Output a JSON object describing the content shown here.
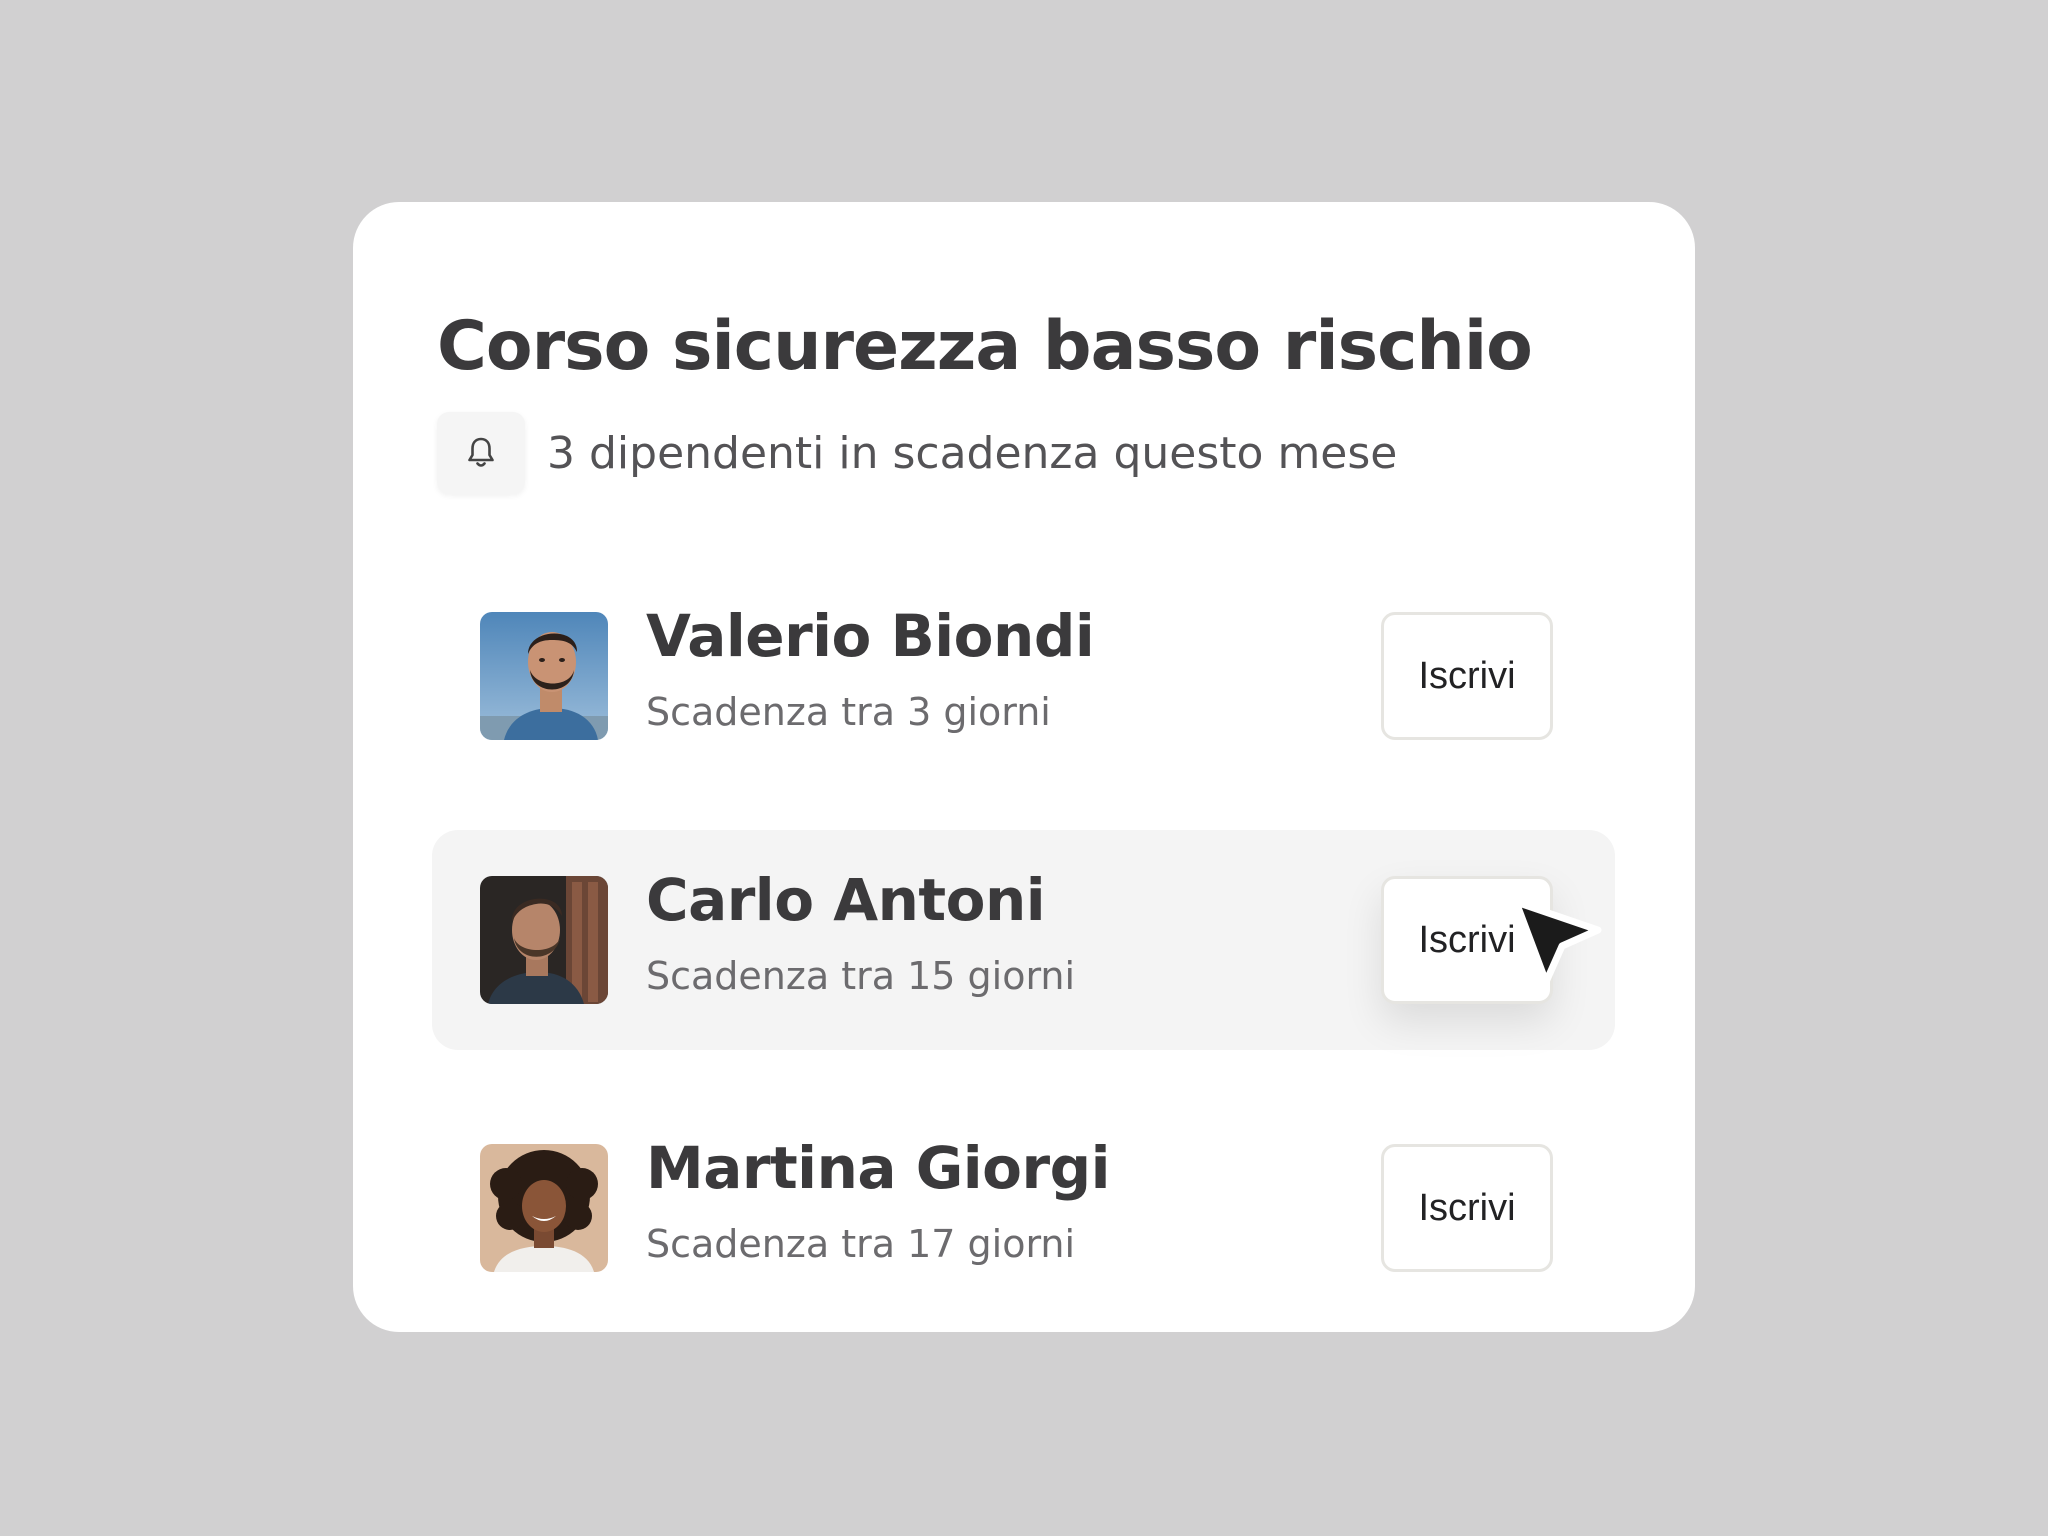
{
  "card": {
    "title": "Corso sicurezza basso rischio",
    "notice": {
      "icon": "bell-icon",
      "text": "3 dipendenti in scadenza questo mese"
    }
  },
  "employees": [
    {
      "name": "Valerio Biondi",
      "due": "Scadenza tra 3 giorni",
      "action_label": "Iscrivi",
      "highlighted": false
    },
    {
      "name": "Carlo Antoni",
      "due": "Scadenza tra 15 giorni",
      "action_label": "Iscrivi",
      "highlighted": true
    },
    {
      "name": "Martina Giorgi",
      "due": "Scadenza tra 17 giorni",
      "action_label": "Iscrivi",
      "highlighted": false
    }
  ],
  "colors": {
    "background": "#d1d0d1",
    "card": "#ffffff",
    "highlight_row": "#f4f4f4",
    "title_text": "#3b3a3c",
    "secondary_text": "#6c6b6e",
    "button_border": "#e6e5e1"
  }
}
